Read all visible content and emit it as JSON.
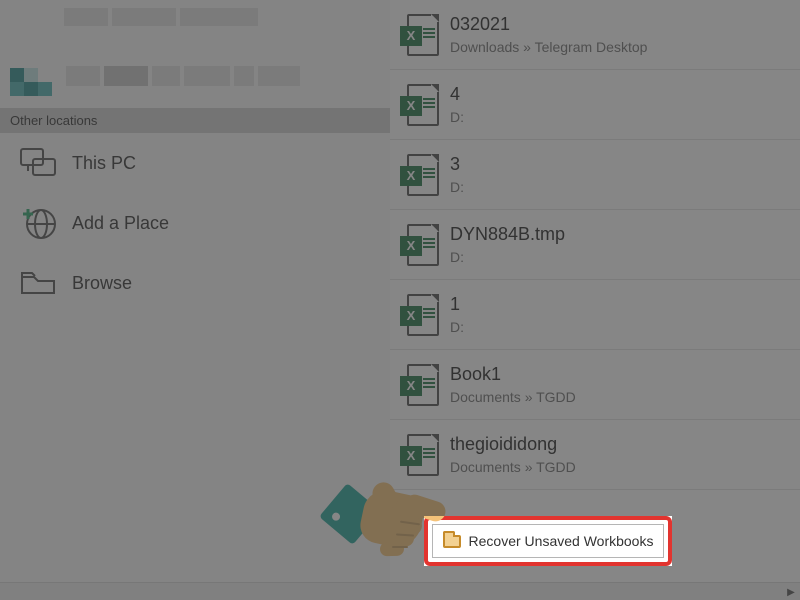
{
  "sidebar": {
    "section_header": "Other locations",
    "items": [
      {
        "label": "This PC"
      },
      {
        "label": "Add a Place"
      },
      {
        "label": "Browse"
      }
    ]
  },
  "files": [
    {
      "name": "032021",
      "path": "Downloads » Telegram Desktop"
    },
    {
      "name": "4",
      "path": "D:"
    },
    {
      "name": "3",
      "path": "D:"
    },
    {
      "name": "DYN884B.tmp",
      "path": "D:"
    },
    {
      "name": "1",
      "path": "D:"
    },
    {
      "name": "Book1",
      "path": "Documents » TGDD"
    },
    {
      "name": "thegioididong",
      "path": "Documents » TGDD"
    }
  ],
  "recover_button": {
    "label": "Recover Unsaved Workbooks"
  }
}
